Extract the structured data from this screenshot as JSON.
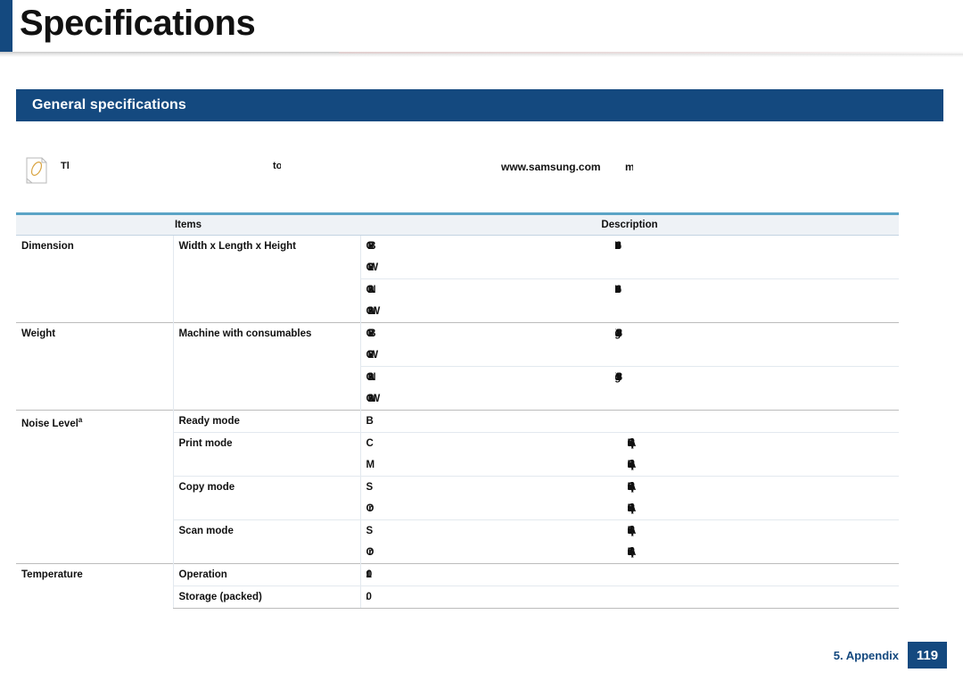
{
  "header": {
    "title": "Specifications",
    "accent_color": "#14497f"
  },
  "section": {
    "title": "General specifications"
  },
  "note": {
    "icon": "note-paper-pencil-icon",
    "text_fragment_1": "The",
    "text_fragment_2": "to",
    "url": "www.samsung.com",
    "url_tail": "m"
  },
  "table": {
    "headers": {
      "items": "Items",
      "description": "Description"
    },
    "rows": [
      {
        "item": "Dimension",
        "sub_item": "Width x Length x Height",
        "entries": [
          {
            "model": "C30xB",
            "value": "406 x 362 x 288 mm (16.0 x 14.3 x 11.4 inches)"
          },
          {
            "model": "C30xW",
            "value": ""
          },
          {
            "model": "C30xN",
            "value": "406 x 362 x 335 mm (16.0 x 14.3 x 13.1 inches)"
          },
          {
            "model": "C30xNW",
            "value": ""
          }
        ]
      },
      {
        "item": "Weight",
        "sub_item": "Machine with consumables",
        "entries": [
          {
            "model": "C30xB",
            "value": "12808 g / 28.22 lbs"
          },
          {
            "model": "C30xW",
            "value": ""
          },
          {
            "model": "C30xN",
            "value": "13968 g / 30.78 lbs"
          },
          {
            "model": "C30xNW",
            "value": ""
          }
        ]
      },
      {
        "item": "Noise Level",
        "item_superscript": "a",
        "sub_rows": [
          {
            "label": "Ready mode",
            "cond": "B",
            "value": ""
          },
          {
            "label": "Print mode",
            "cond": "C",
            "value": "56 dB(A)"
          },
          {
            "label": "",
            "cond": "M",
            "value": "58 dB(A)"
          },
          {
            "label": "Copy mode",
            "cond": "S",
            "value": "52 dB(A)"
          },
          {
            "label": "",
            "cond": "Or",
            "value": "53 dB(A)"
          },
          {
            "label": "Scan mode",
            "cond": "S",
            "value": "51 dB(A)"
          },
          {
            "label": "",
            "cond": "Or",
            "value": "51 dB(A)"
          }
        ]
      },
      {
        "item": "Temperature",
        "sub_rows": [
          {
            "label": "Operation",
            "value": "10 to 32 °C (50 to 89.6 °F)"
          },
          {
            "label": "Storage (packed)",
            "value": "0 to 40 °C (32 to 104 °F)"
          }
        ]
      }
    ]
  },
  "footer": {
    "chapter": "5. Appendix",
    "page_number": "119"
  }
}
